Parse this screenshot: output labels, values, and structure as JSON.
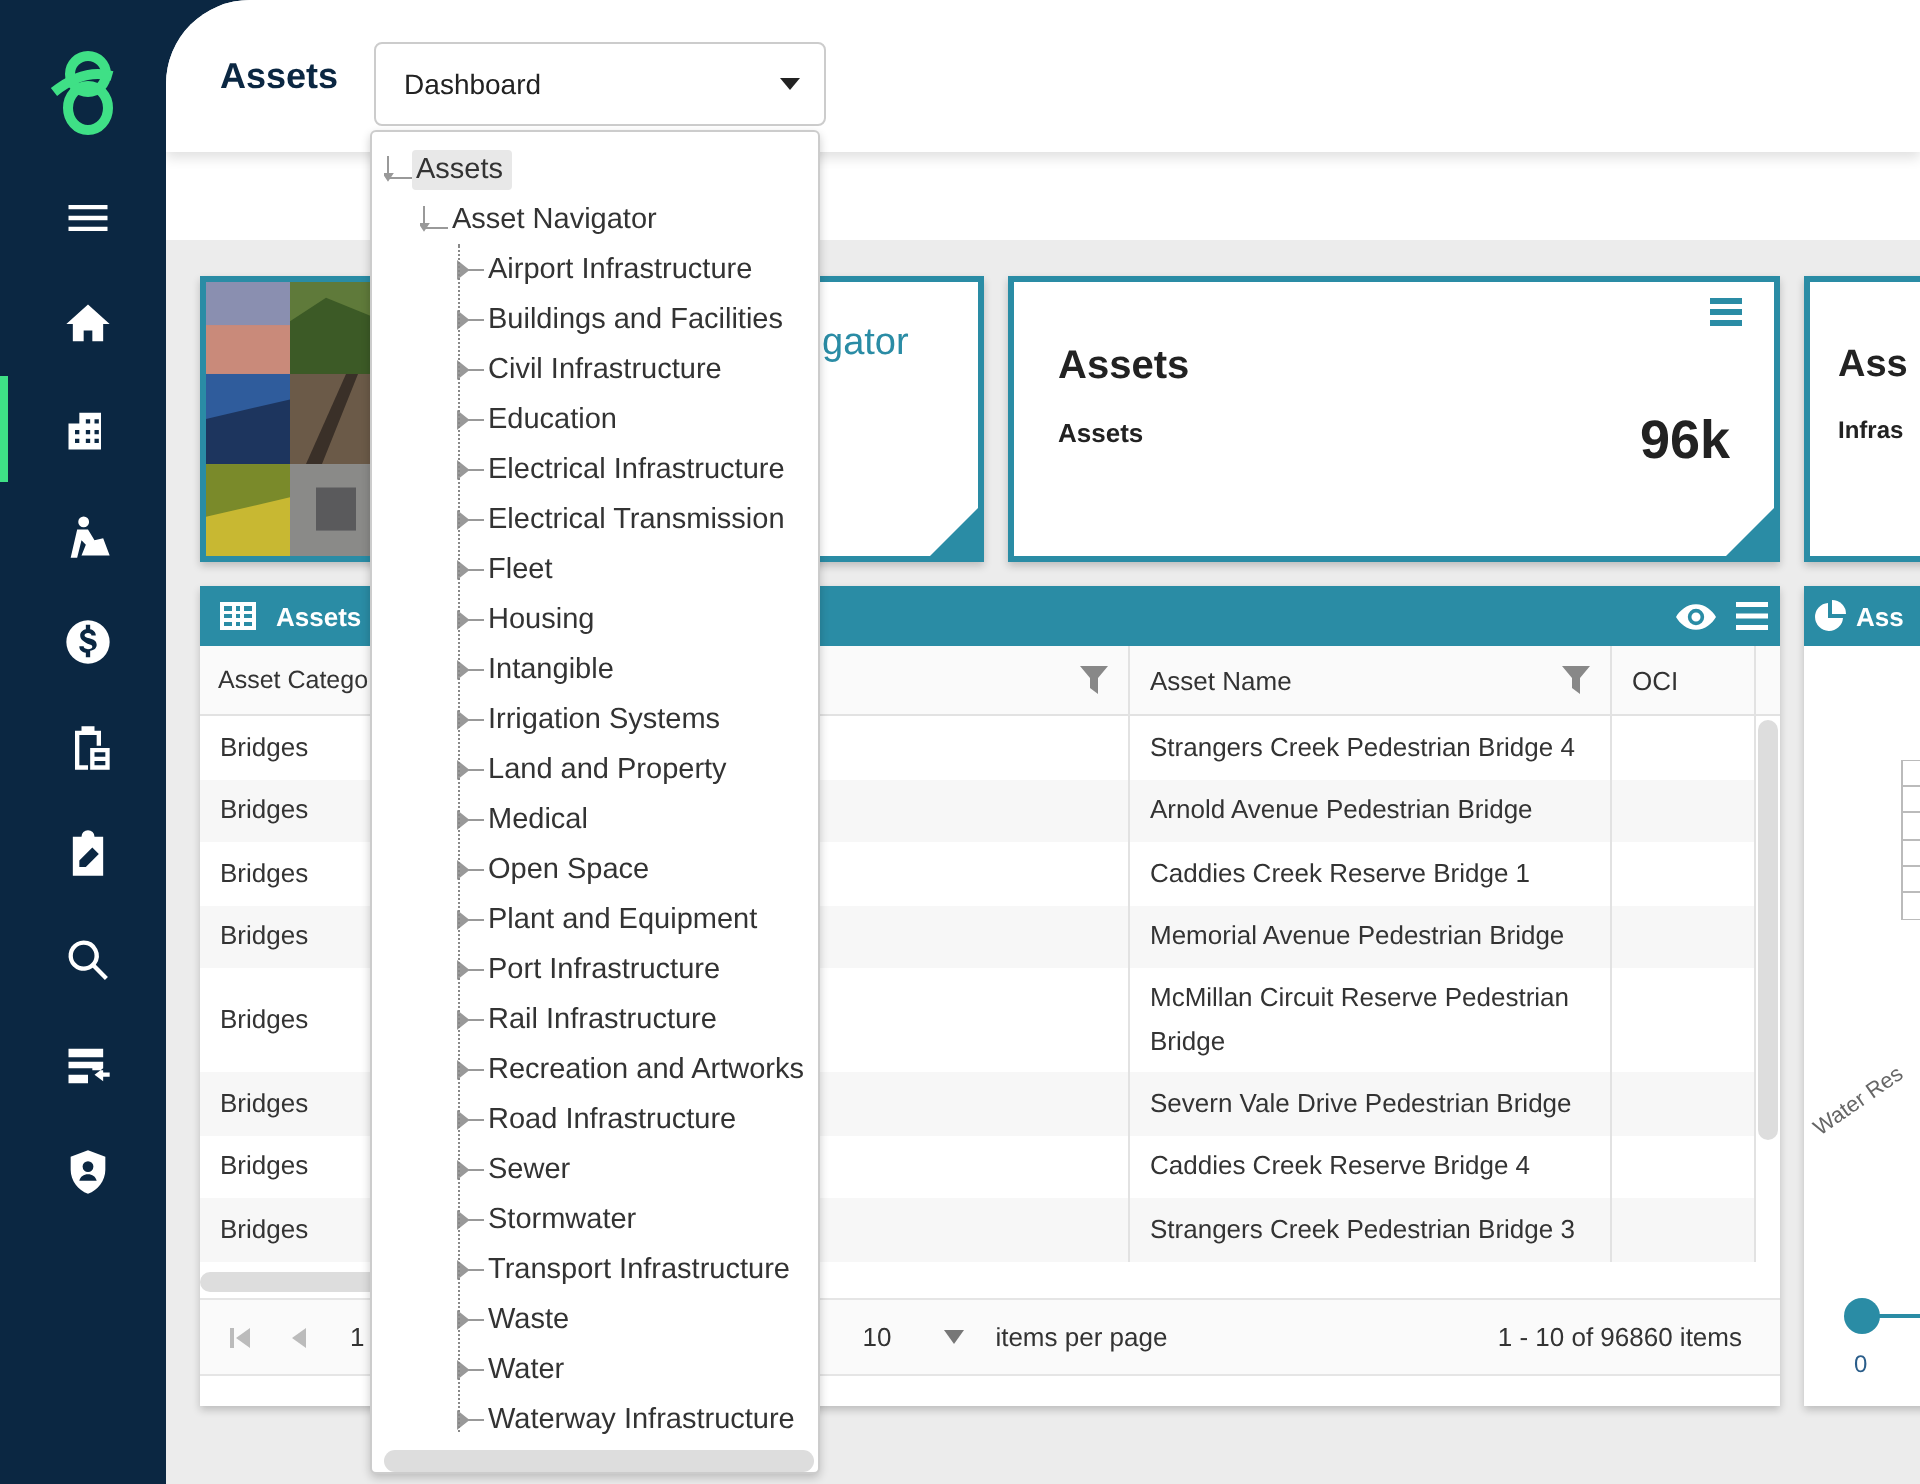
{
  "sidebar": {
    "items": [
      {
        "selected": false
      },
      {
        "selected": false
      },
      {
        "selected": true
      },
      {
        "selected": false
      },
      {
        "selected": false
      },
      {
        "selected": false
      },
      {
        "selected": false
      },
      {
        "selected": false
      },
      {
        "selected": false
      },
      {
        "selected": false
      }
    ]
  },
  "header": {
    "title": "Assets",
    "select": {
      "value": "Dashboard"
    }
  },
  "tree": [
    {
      "label": "Assets",
      "selected": true,
      "expanded": true,
      "children": [
        {
          "label": "Asset Navigator",
          "selected": false,
          "expanded": true,
          "children": [
            {
              "label": "Airport Infrastructure",
              "selected": false,
              "expanded": false
            },
            {
              "label": "Buildings and Facilities",
              "selected": false,
              "expanded": false
            },
            {
              "label": "Civil Infrastructure",
              "selected": false,
              "expanded": false
            },
            {
              "label": "Education",
              "selected": false,
              "expanded": false
            },
            {
              "label": "Electrical Infrastructure",
              "selected": false,
              "expanded": false
            },
            {
              "label": "Electrical Transmission",
              "selected": false,
              "expanded": false
            },
            {
              "label": "Fleet",
              "selected": false,
              "expanded": false
            },
            {
              "label": "Housing",
              "selected": false,
              "expanded": false
            },
            {
              "label": "Intangible",
              "selected": false,
              "expanded": false
            },
            {
              "label": "Irrigation Systems",
              "selected": false,
              "expanded": false
            },
            {
              "label": "Land and Property",
              "selected": false,
              "expanded": false
            },
            {
              "label": "Medical",
              "selected": false,
              "expanded": false
            },
            {
              "label": "Open Space",
              "selected": false,
              "expanded": false
            },
            {
              "label": "Plant and Equipment",
              "selected": false,
              "expanded": false
            },
            {
              "label": "Port Infrastructure",
              "selected": false,
              "expanded": false
            },
            {
              "label": "Rail Infrastructure",
              "selected": false,
              "expanded": false
            },
            {
              "label": "Recreation and Artworks",
              "selected": false,
              "expanded": false
            },
            {
              "label": "Road Infrastructure",
              "selected": false,
              "expanded": false
            },
            {
              "label": "Sewer",
              "selected": false,
              "expanded": false
            },
            {
              "label": "Stormwater",
              "selected": false,
              "expanded": false
            },
            {
              "label": "Transport Infrastructure",
              "selected": false,
              "expanded": false
            },
            {
              "label": "Waste",
              "selected": false,
              "expanded": false
            },
            {
              "label": "Water",
              "selected": false,
              "expanded": false
            },
            {
              "label": "Waterway Infrastructure",
              "selected": false,
              "expanded": false
            }
          ]
        }
      ]
    }
  ],
  "cards": [
    {
      "kind": "picture",
      "title": "gator"
    },
    {
      "kind": "stat",
      "title": "Assets",
      "label": "Assets",
      "value": "96k"
    },
    {
      "kind": "stat",
      "title": "Ass",
      "label": "Infras"
    }
  ],
  "table_panel": {
    "title": "Assets",
    "columns": [
      "Asset Catego",
      "Asset Name",
      "OCI"
    ],
    "rows": [
      {
        "category": "Bridges",
        "name": "Strangers Creek Pedestrian Bridge 4"
      },
      {
        "category": "Bridges",
        "name": "Arnold Avenue Pedestrian Bridge"
      },
      {
        "category": "Bridges",
        "name": "Caddies Creek Reserve Bridge 1"
      },
      {
        "category": "Bridges",
        "name": "Memorial Avenue Pedestrian Bridge"
      },
      {
        "category": "Bridges",
        "name": "McMillan Circuit Reserve Pedestrian Bridge"
      },
      {
        "category": "Bridges",
        "name": "Severn Vale Drive Pedestrian Bridge"
      },
      {
        "category": "Bridges",
        "name": "Caddies Creek Reserve Bridge 4"
      },
      {
        "category": "Bridges",
        "name": "Strangers Creek Pedestrian Bridge 3"
      }
    ],
    "pager": {
      "page": "1",
      "page_size": "10",
      "page_size_label": "items per page",
      "summary": "1 - 10 of 96860 items"
    }
  },
  "chart_panel": {
    "title": "Ass",
    "axis_label": "Water Res",
    "slider": {
      "level": 0,
      "label": "0"
    }
  }
}
